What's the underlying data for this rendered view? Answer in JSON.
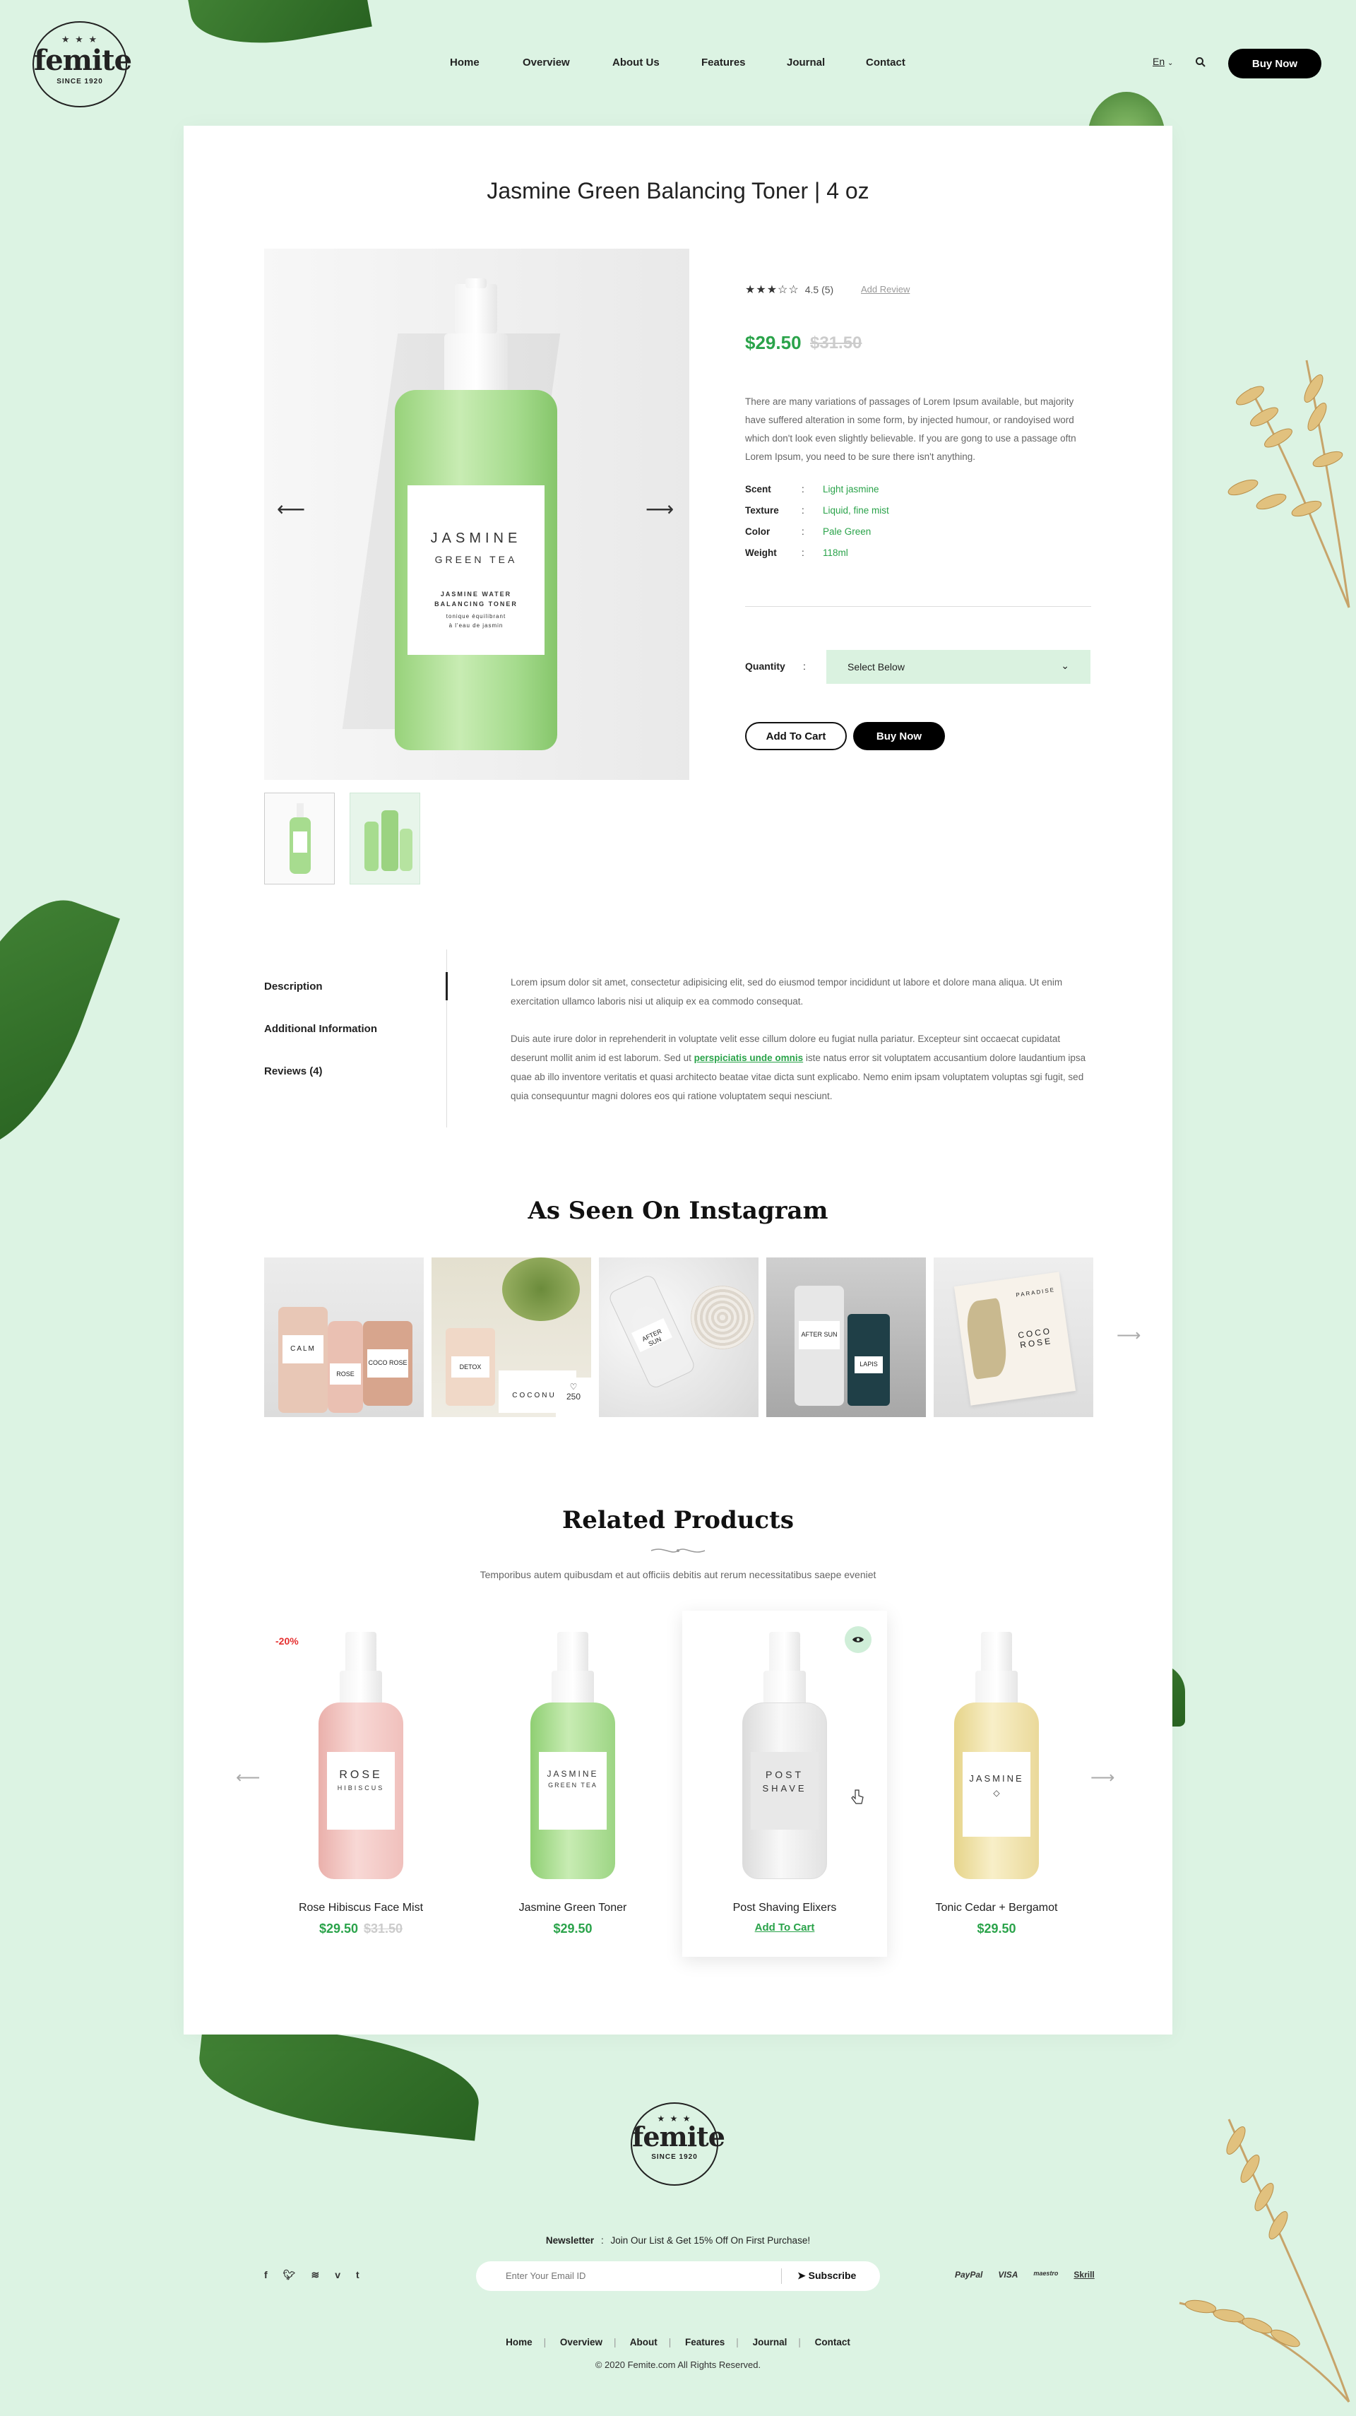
{
  "brand": {
    "stars": "★ ★ ★",
    "name": "femite",
    "since": "SINCE 1920"
  },
  "nav": [
    "Home",
    "Overview",
    "About Us",
    "Features",
    "Journal",
    "Contact"
  ],
  "header": {
    "lang": "En",
    "buy_now": "Buy Now"
  },
  "product": {
    "title": "Jasmine Green Balancing Toner | 4 oz",
    "rating_stars": "★★★☆☆",
    "rating_value": 3,
    "rating_text": "4.5 (5)",
    "add_review": "Add Review",
    "price": "$29.50",
    "old_price": "$31.50",
    "description": "There are many variations of passages of Lorem Ipsum available, but majority have suffered alteration in some form, by injected humour, or randoyised word which don't look even slightly believable. If you are gong to use a passage oftn Lorem Ipsum, you need to be sure there isn't anything.",
    "specs": [
      {
        "key": "Scent",
        "value": "Light jasmine"
      },
      {
        "key": "Texture",
        "value": "Liquid, fine mist"
      },
      {
        "key": "Color",
        "value": "Pale Green"
      },
      {
        "key": "Weight",
        "value": "118ml"
      }
    ],
    "spec_sep": ":",
    "quantity_label": "Quantity",
    "quantity_select": "Select Below",
    "add_to_cart": "Add To Cart",
    "buy_now": "Buy Now",
    "arrow_left": "⟵",
    "arrow_right": "⟶",
    "bottle_label": {
      "line1": "JASMINE",
      "line2": "GREEN TEA",
      "line3": "JASMINE WATER",
      "line4": "BALANCING TONER",
      "line5": "tonique équilibrant",
      "line6": "à l'eau de jasmin"
    }
  },
  "tabs": {
    "items": [
      "Description",
      "Additional Information",
      "Reviews (4)"
    ],
    "para1": "Lorem ipsum dolor sit amet, consectetur adipisicing elit, sed do eiusmod tempor incididunt ut labore et dolore mana aliqua. Ut enim exercitation ullamco laboris nisi ut aliquip ex ea commodo consequat.",
    "para2_before": "Duis aute irure dolor in reprehenderit in voluptate velit esse cillum dolore eu fugiat nulla pariatur. Excepteur sint occaecat cupidatat deserunt mollit anim id est laborum. Sed ut ",
    "para2_link": "perspiciatis unde omnis",
    "para2_after": " iste natus error sit voluptatem accusantium dolore laudantium ipsa quae ab illo inventore veritatis et quasi architecto beatae vitae dicta sunt explicabo. Nemo enim ipsam voluptatem voluptas sgi fugit, sed quia consequuntur magni dolores eos qui ratione voluptatem sequi nesciunt."
  },
  "instagram": {
    "title": "As Seen On Instagram",
    "likes": "250",
    "next": "⟶",
    "labels": [
      {
        "a": "CALM",
        "b": "ROSE",
        "c": "COCO ROSE"
      },
      {
        "a": "DETOX",
        "b": "COCONUT"
      },
      {
        "a": "AFTER SUN"
      },
      {
        "a": "AFTER SUN",
        "b": "LAPIS"
      },
      {
        "a": "PARADISE",
        "b": "COCO ROSE"
      }
    ]
  },
  "related": {
    "title": "Related Products",
    "subtitle": "Temporibus autem quibusdam et aut officiis debitis aut rerum necessitatibus saepe eveniet",
    "badge": "-20%",
    "prev": "⟵",
    "next": "⟶",
    "products": [
      {
        "name": "Rose Hibiscus Face Mist",
        "price": "$29.50",
        "old_price": "$31.50",
        "label1": "ROSE",
        "label2": "HIBISCUS",
        "color": "#f3c6c3"
      },
      {
        "name": "Jasmine Green Toner",
        "price": "$29.50",
        "label1": "JASMINE",
        "label2": "GREEN TEA",
        "color": "#a7dc8f"
      },
      {
        "name": "Post Shaving Elixers",
        "add_to_cart": "Add To Cart",
        "label1": "POST",
        "label2": "SHAVE",
        "color": "#eeeeee"
      },
      {
        "name": "Tonic Cedar + Bergamot",
        "price": "$29.50",
        "label1": "JASMINE",
        "label2": "◇",
        "color": "#f2e6b0"
      }
    ]
  },
  "footer": {
    "newsletter_label": "Newsletter",
    "newsletter_text": "Join Our List & Get 15% Off On First Purchase!",
    "email_placeholder": "Enter Your Email ID",
    "subscribe": "Subscribe",
    "social": [
      "f",
      "t",
      "rss",
      "v",
      "t"
    ],
    "payments": [
      "PayPal",
      "VISA",
      "maestro",
      "Skrill"
    ],
    "nav": [
      "Home",
      "Overview",
      "About",
      "Features",
      "Journal",
      "Contact"
    ],
    "copyright": "© 2020 Femite.com All Rights Reserved."
  },
  "colors": {
    "background": "#dcf3e3",
    "accent": "#2aa34a",
    "select_bg": "#daf2e0",
    "badge": "#e53030"
  }
}
